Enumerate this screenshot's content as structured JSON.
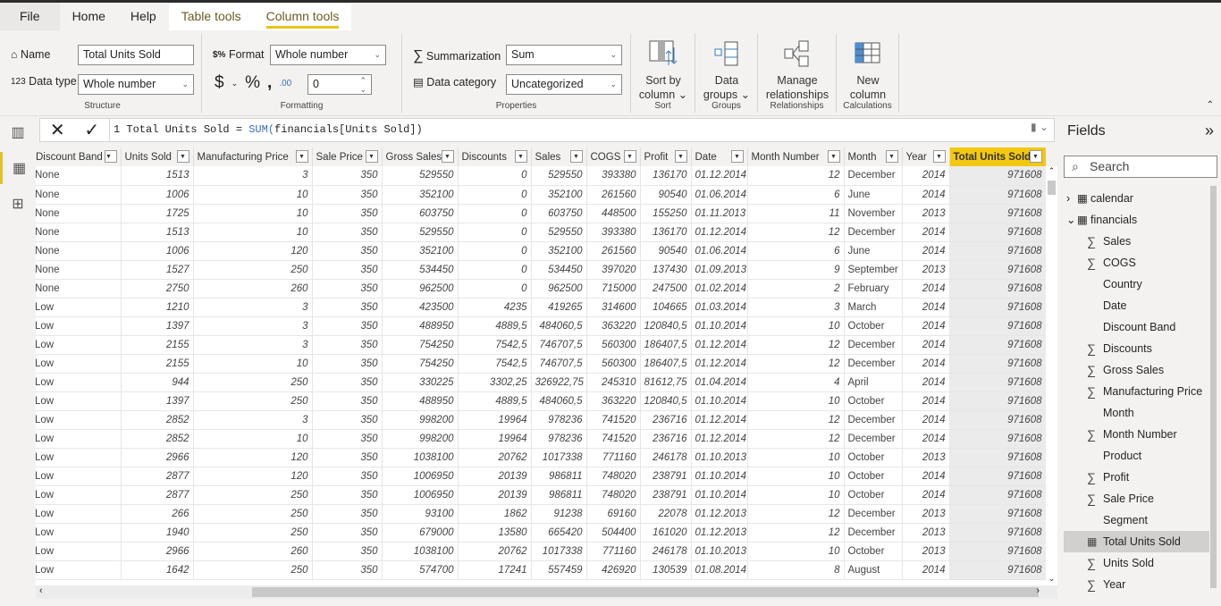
{
  "tabs": [
    {
      "label": "File"
    },
    {
      "label": "Home"
    },
    {
      "label": "Help"
    },
    {
      "label": "Table tools"
    },
    {
      "label": "Column tools"
    }
  ],
  "ribbon": {
    "structure": {
      "name_label": "Name",
      "name_value": "Total Units Sold",
      "datatype_label": "Data type",
      "datatype_value": "Whole number",
      "group": "Structure"
    },
    "formatting": {
      "format_label": "Format",
      "format_value": "Whole number",
      "currency": "$",
      "percent": "%",
      "comma": "ʙ",
      "decimals": "0",
      "group": "Formatting"
    },
    "properties": {
      "summarization_label": "Summarization",
      "summarization_value": "Sum",
      "category_label": "Data category",
      "category_value": "Uncategorized",
      "group": "Properties"
    },
    "sort": {
      "label1": "Sort by",
      "label2": "column",
      "group": "Sort"
    },
    "groups": {
      "label1": "Data",
      "label2": "groups",
      "group": "Groups"
    },
    "relationships": {
      "label1": "Manage",
      "label2": "relationships",
      "group": "Relationships"
    },
    "calculations": {
      "label1": "New",
      "label2": "column",
      "group": "Calculations"
    }
  },
  "formula": {
    "line": "1",
    "prefix": "Total Units Sold = ",
    "fn": "SUM(",
    "arg": "financials[Units Sold]",
    "close": ")"
  },
  "table": {
    "columns": [
      "Discount Band",
      "Units Sold",
      "Manufacturing Price",
      "Sale Price",
      "Gross Sales",
      "Discounts",
      "Sales",
      "COGS",
      "Profit",
      "Date",
      "Month Number",
      "Month",
      "Year",
      "Total Units Sold"
    ],
    "selected_column": "Total Units Sold",
    "rows": [
      [
        "None",
        "1513",
        "3",
        "350",
        "529550",
        "0",
        "529550",
        "393380",
        "136170",
        "01.12.2014",
        "12",
        "December",
        "2014",
        "971608"
      ],
      [
        "None",
        "1006",
        "10",
        "350",
        "352100",
        "0",
        "352100",
        "261560",
        "90540",
        "01.06.2014",
        "6",
        "June",
        "2014",
        "971608"
      ],
      [
        "None",
        "1725",
        "10",
        "350",
        "603750",
        "0",
        "603750",
        "448500",
        "155250",
        "01.11.2013",
        "11",
        "November",
        "2013",
        "971608"
      ],
      [
        "None",
        "1513",
        "10",
        "350",
        "529550",
        "0",
        "529550",
        "393380",
        "136170",
        "01.12.2014",
        "12",
        "December",
        "2014",
        "971608"
      ],
      [
        "None",
        "1006",
        "120",
        "350",
        "352100",
        "0",
        "352100",
        "261560",
        "90540",
        "01.06.2014",
        "6",
        "June",
        "2014",
        "971608"
      ],
      [
        "None",
        "1527",
        "250",
        "350",
        "534450",
        "0",
        "534450",
        "397020",
        "137430",
        "01.09.2013",
        "9",
        "September",
        "2013",
        "971608"
      ],
      [
        "None",
        "2750",
        "260",
        "350",
        "962500",
        "0",
        "962500",
        "715000",
        "247500",
        "01.02.2014",
        "2",
        "February",
        "2014",
        "971608"
      ],
      [
        "Low",
        "1210",
        "3",
        "350",
        "423500",
        "4235",
        "419265",
        "314600",
        "104665",
        "01.03.2014",
        "3",
        "March",
        "2014",
        "971608"
      ],
      [
        "Low",
        "1397",
        "3",
        "350",
        "488950",
        "4889,5",
        "484060,5",
        "363220",
        "120840,5",
        "01.10.2014",
        "10",
        "October",
        "2014",
        "971608"
      ],
      [
        "Low",
        "2155",
        "3",
        "350",
        "754250",
        "7542,5",
        "746707,5",
        "560300",
        "186407,5",
        "01.12.2014",
        "12",
        "December",
        "2014",
        "971608"
      ],
      [
        "Low",
        "2155",
        "10",
        "350",
        "754250",
        "7542,5",
        "746707,5",
        "560300",
        "186407,5",
        "01.12.2014",
        "12",
        "December",
        "2014",
        "971608"
      ],
      [
        "Low",
        "944",
        "250",
        "350",
        "330225",
        "3302,25",
        "326922,75",
        "245310",
        "81612,75",
        "01.04.2014",
        "4",
        "April",
        "2014",
        "971608"
      ],
      [
        "Low",
        "1397",
        "250",
        "350",
        "488950",
        "4889,5",
        "484060,5",
        "363220",
        "120840,5",
        "01.10.2014",
        "10",
        "October",
        "2014",
        "971608"
      ],
      [
        "Low",
        "2852",
        "3",
        "350",
        "998200",
        "19964",
        "978236",
        "741520",
        "236716",
        "01.12.2014",
        "12",
        "December",
        "2014",
        "971608"
      ],
      [
        "Low",
        "2852",
        "10",
        "350",
        "998200",
        "19964",
        "978236",
        "741520",
        "236716",
        "01.12.2014",
        "12",
        "December",
        "2014",
        "971608"
      ],
      [
        "Low",
        "2966",
        "120",
        "350",
        "1038100",
        "20762",
        "1017338",
        "771160",
        "246178",
        "01.10.2013",
        "10",
        "October",
        "2013",
        "971608"
      ],
      [
        "Low",
        "2877",
        "120",
        "350",
        "1006950",
        "20139",
        "986811",
        "748020",
        "238791",
        "01.10.2014",
        "10",
        "October",
        "2014",
        "971608"
      ],
      [
        "Low",
        "2877",
        "250",
        "350",
        "1006950",
        "20139",
        "986811",
        "748020",
        "238791",
        "01.10.2014",
        "10",
        "October",
        "2014",
        "971608"
      ],
      [
        "Low",
        "266",
        "250",
        "350",
        "93100",
        "1862",
        "91238",
        "69160",
        "22078",
        "01.12.2013",
        "12",
        "December",
        "2013",
        "971608"
      ],
      [
        "Low",
        "1940",
        "250",
        "350",
        "679000",
        "13580",
        "665420",
        "504400",
        "161020",
        "01.12.2013",
        "12",
        "December",
        "2013",
        "971608"
      ],
      [
        "Low",
        "2966",
        "260",
        "350",
        "1038100",
        "20762",
        "1017338",
        "771160",
        "246178",
        "01.10.2013",
        "10",
        "October",
        "2013",
        "971608"
      ],
      [
        "Low",
        "1642",
        "250",
        "350",
        "574700",
        "17241",
        "557459",
        "426920",
        "130539",
        "01.08.2014",
        "8",
        "August",
        "2014",
        "971608"
      ]
    ]
  },
  "fields": {
    "title": "Fields",
    "search_placeholder": "Search",
    "tables": [
      {
        "name": "calendar",
        "expanded": false
      },
      {
        "name": "financials",
        "expanded": true
      }
    ],
    "items": [
      {
        "name": "Sales",
        "sigma": true
      },
      {
        "name": "COGS",
        "sigma": true
      },
      {
        "name": "Country",
        "sigma": false
      },
      {
        "name": "Date",
        "sigma": false
      },
      {
        "name": "Discount Band",
        "sigma": false
      },
      {
        "name": "Discounts",
        "sigma": true
      },
      {
        "name": "Gross Sales",
        "sigma": true
      },
      {
        "name": "Manufacturing Price",
        "sigma": true
      },
      {
        "name": "Month",
        "sigma": false
      },
      {
        "name": "Month Number",
        "sigma": true
      },
      {
        "name": "Product",
        "sigma": false
      },
      {
        "name": "Profit",
        "sigma": true
      },
      {
        "name": "Sale Price",
        "sigma": true
      },
      {
        "name": "Segment",
        "sigma": false
      },
      {
        "name": "Total Units Sold",
        "sigma": false,
        "measure": true,
        "selected": true
      },
      {
        "name": "Units Sold",
        "sigma": true
      },
      {
        "name": "Year",
        "sigma": true
      }
    ]
  },
  "colors": {
    "accent": "#f2c811",
    "ribbon_bg": "#f3f2f1",
    "formula_fn": "#3a6fbf"
  }
}
